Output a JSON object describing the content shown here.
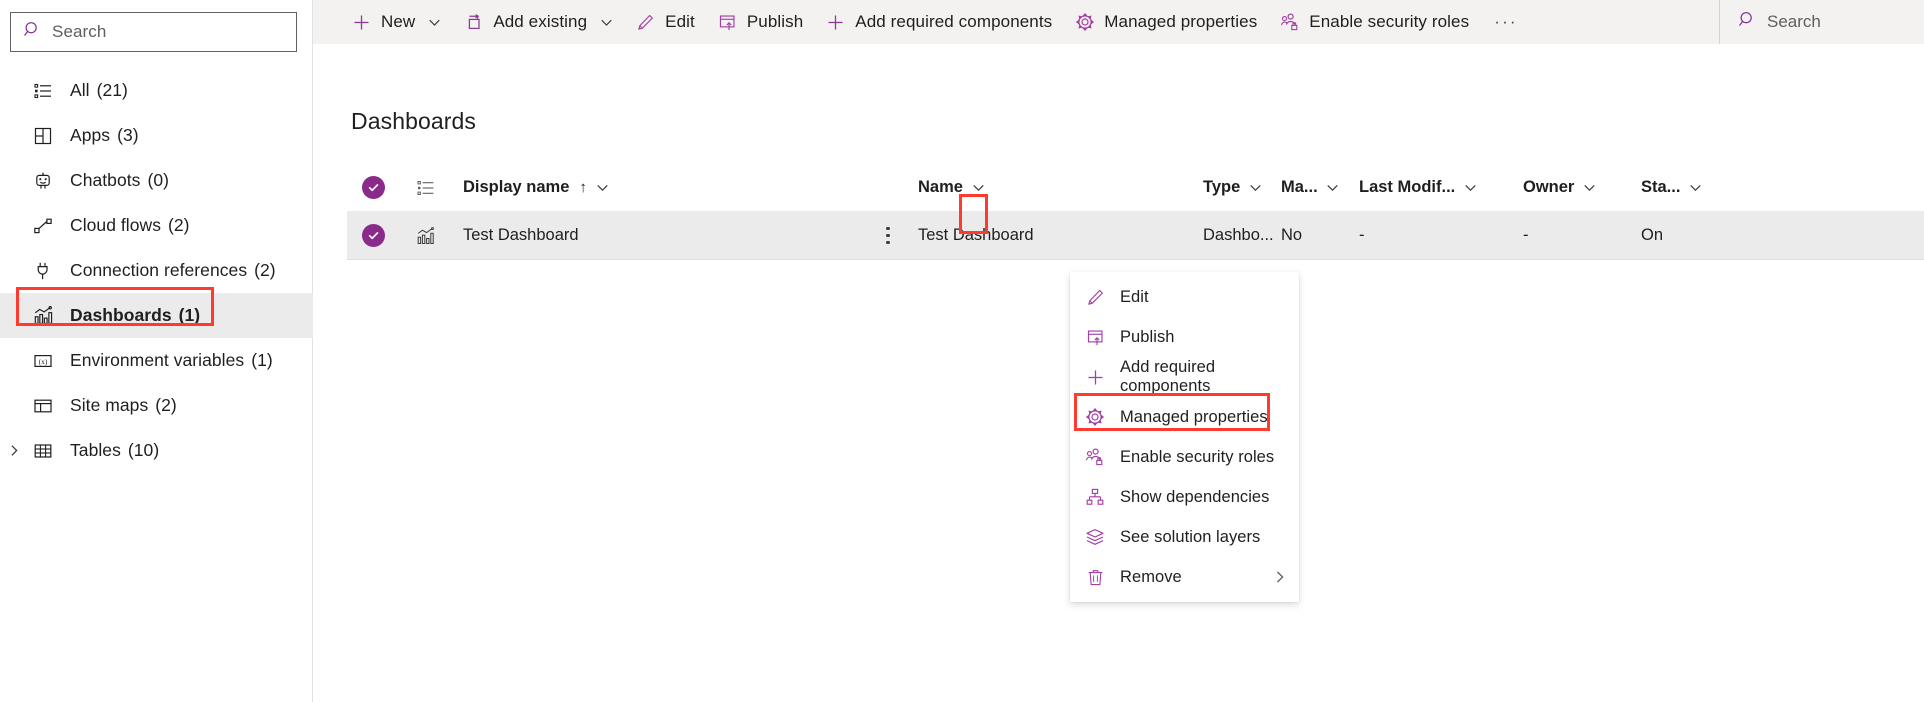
{
  "sidebar": {
    "search": {
      "placeholder": "Search",
      "icon": "search-icon"
    },
    "items": [
      {
        "label": "All",
        "count": "(21)",
        "icon": "list-icon"
      },
      {
        "label": "Apps",
        "count": "(3)",
        "icon": "apps-grid-icon"
      },
      {
        "label": "Chatbots",
        "count": "(0)",
        "icon": "chatbot-icon"
      },
      {
        "label": "Cloud flows",
        "count": "(2)",
        "icon": "cloud-flow-icon"
      },
      {
        "label": "Connection references",
        "count": "(2)",
        "icon": "connection-plug-icon"
      },
      {
        "label": "Dashboards",
        "count": "(1)",
        "icon": "dashboard-chart-icon"
      },
      {
        "label": "Environment variables",
        "count": "(1)",
        "icon": "variable-icon"
      },
      {
        "label": "Site maps",
        "count": "(2)",
        "icon": "sitemap-layout-icon"
      },
      {
        "label": "Tables",
        "count": "(10)",
        "icon": "table-grid-icon"
      }
    ],
    "active_index": 5,
    "expandable_index": 8
  },
  "toolbar": {
    "buttons": [
      {
        "label": "New",
        "icon": "plus-icon",
        "caret": true
      },
      {
        "label": "Add existing",
        "icon": "add-existing-icon",
        "caret": true
      },
      {
        "label": "Edit",
        "icon": "pencil-icon",
        "caret": false
      },
      {
        "label": "Publish",
        "icon": "publish-upload-icon",
        "caret": false
      },
      {
        "label": "Add required components",
        "icon": "plus-icon",
        "caret": false
      },
      {
        "label": "Managed properties",
        "icon": "gear-icon",
        "caret": false
      },
      {
        "label": "Enable security roles",
        "icon": "security-roles-icon",
        "caret": false
      }
    ],
    "overflow_label": "···",
    "search": {
      "placeholder": "Search",
      "icon": "search-icon"
    }
  },
  "page": {
    "title": "Dashboards"
  },
  "grid": {
    "headers": {
      "display_name": "Display name",
      "sort_indicator": "↑",
      "name": "Name",
      "type": "Type",
      "managed": "Ma...",
      "last_modified": "Last Modif...",
      "owner": "Owner",
      "status": "Sta..."
    },
    "rows": [
      {
        "selected": true,
        "icon": "dashboard-chart-icon",
        "display_name": "Test Dashboard",
        "name": "Test Dashboard",
        "type": "Dashbo...",
        "managed": "No",
        "last_modified": "-",
        "owner": "-",
        "status": "On"
      }
    ]
  },
  "context_menu": {
    "items": [
      {
        "label": "Edit",
        "icon": "pencil-icon",
        "submenu": false,
        "highlighted": false
      },
      {
        "label": "Publish",
        "icon": "publish-upload-icon",
        "submenu": false,
        "highlighted": false
      },
      {
        "label": "Add required components",
        "icon": "plus-icon",
        "submenu": false,
        "highlighted": false
      },
      {
        "label": "Managed properties",
        "icon": "gear-icon",
        "submenu": false,
        "highlighted": false
      },
      {
        "label": "Enable security roles",
        "icon": "security-roles-icon",
        "submenu": false,
        "highlighted": true
      },
      {
        "label": "Show dependencies",
        "icon": "dependencies-icon",
        "submenu": false,
        "highlighted": false
      },
      {
        "label": "See solution layers",
        "icon": "layers-icon",
        "submenu": false,
        "highlighted": false
      },
      {
        "label": "Remove",
        "icon": "trash-icon",
        "submenu": true,
        "highlighted": false
      }
    ]
  },
  "colors": {
    "accent": "#8a2a8a",
    "icon_purple": "#a33ea3",
    "highlight_red": "#ff3b30",
    "toolbar_bg": "#f3f2f1",
    "row_selected_bg": "#ebebeb",
    "text": "#201f1e"
  },
  "annotations": [
    {
      "name": "sidebar-dashboards-highlight",
      "target": "Dashboards"
    },
    {
      "name": "row-kebab-highlight",
      "target": "row context menu button"
    },
    {
      "name": "menu-enable-security-roles-highlight",
      "target": "Enable security roles"
    }
  ]
}
